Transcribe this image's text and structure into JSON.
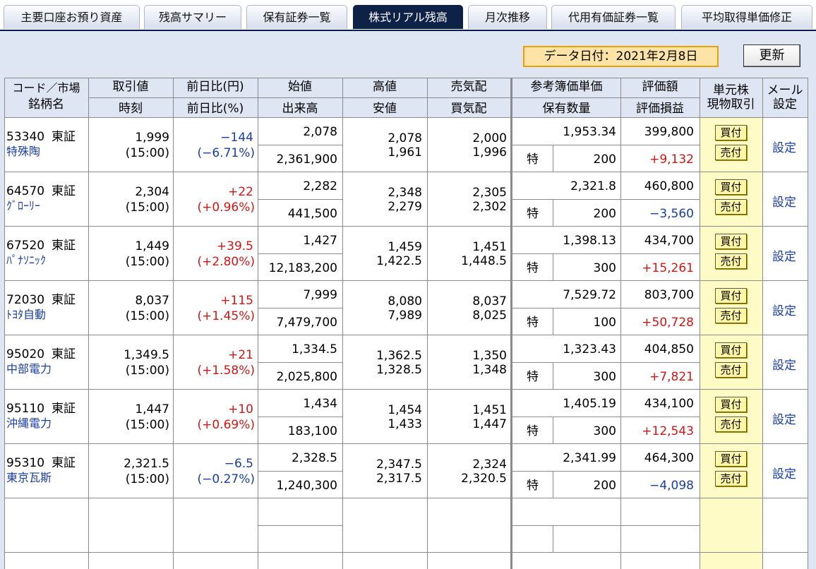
{
  "tabs": [
    {
      "label": "主要口座お預り資産",
      "active": false
    },
    {
      "label": "残高サマリー",
      "active": false
    },
    {
      "label": "保有証券一覧",
      "active": false
    },
    {
      "label": "株式リアル残高",
      "active": true
    },
    {
      "label": "月次推移",
      "active": false
    },
    {
      "label": "代用有価証券一覧",
      "active": false
    },
    {
      "label": "平均取得単価修正",
      "active": false
    }
  ],
  "toolbar": {
    "date_label": "データ日付：2021年2月8日",
    "update_label": "更新"
  },
  "headers": {
    "code_market": "コード／市場",
    "name": "銘柄名",
    "trade_price": "取引値",
    "time": "時刻",
    "change_yen": "前日比(円)",
    "change_pct": "前日比(%)",
    "open": "始値",
    "volume": "出来高",
    "high": "高値",
    "low": "安値",
    "ask": "売気配",
    "bid": "買気配",
    "ref_price": "参考簿価単価",
    "holding_qty": "保有数量",
    "valuation": "評価額",
    "pl": "評価損益",
    "unit_trade_1": "単元株",
    "unit_trade_2": "現物取引",
    "mail_1": "メール",
    "mail_2": "設定"
  },
  "colors": {
    "positive": "#d41515",
    "negative": "#1a3ea1",
    "accent": "#0e2146"
  },
  "buttons": {
    "buy": "買付",
    "sell": "売付",
    "setting": "設定"
  },
  "rows": [
    {
      "code": "53340",
      "market": "東証",
      "name": "特殊陶",
      "price": "1,999",
      "time": "(15:00)",
      "chg": "−144",
      "chg_pct": "(−6.71%)",
      "dir": "down",
      "open": "2,078",
      "volume": "2,361,900",
      "high": "2,078",
      "low": "1,961",
      "ask": "2,000",
      "bid": "1,996",
      "ref": "1,953.34",
      "type": "特",
      "qty": "200",
      "value": "399,800",
      "pl": "+9,132",
      "pl_dir": "up"
    },
    {
      "code": "64570",
      "market": "東証",
      "name": "ｸﾞﾛｰﾘｰ",
      "price": "2,304",
      "time": "(15:00)",
      "chg": "+22",
      "chg_pct": "(+0.96%)",
      "dir": "up",
      "open": "2,282",
      "volume": "441,500",
      "high": "2,348",
      "low": "2,279",
      "ask": "2,305",
      "bid": "2,302",
      "ref": "2,321.8",
      "type": "特",
      "qty": "200",
      "value": "460,800",
      "pl": "−3,560",
      "pl_dir": "down"
    },
    {
      "code": "67520",
      "market": "東証",
      "name": "ﾊﾟﾅｿﾆｯｸ",
      "price": "1,449",
      "time": "(15:00)",
      "chg": "+39.5",
      "chg_pct": "(+2.80%)",
      "dir": "up",
      "open": "1,427",
      "volume": "12,183,200",
      "high": "1,459",
      "low": "1,422.5",
      "ask": "1,451",
      "bid": "1,448.5",
      "ref": "1,398.13",
      "type": "特",
      "qty": "300",
      "value": "434,700",
      "pl": "+15,261",
      "pl_dir": "up"
    },
    {
      "code": "72030",
      "market": "東証",
      "name": "ﾄﾖﾀ自動",
      "price": "8,037",
      "time": "(15:00)",
      "chg": "+115",
      "chg_pct": "(+1.45%)",
      "dir": "up",
      "open": "7,999",
      "volume": "7,479,700",
      "high": "8,080",
      "low": "7,989",
      "ask": "8,037",
      "bid": "8,025",
      "ref": "7,529.72",
      "type": "特",
      "qty": "100",
      "value": "803,700",
      "pl": "+50,728",
      "pl_dir": "up"
    },
    {
      "code": "95020",
      "market": "東証",
      "name": "中部電力",
      "price": "1,349.5",
      "time": "(15:00)",
      "chg": "+21",
      "chg_pct": "(+1.58%)",
      "dir": "up",
      "open": "1,334.5",
      "volume": "2,025,800",
      "high": "1,362.5",
      "low": "1,328.5",
      "ask": "1,350",
      "bid": "1,348",
      "ref": "1,323.43",
      "type": "特",
      "qty": "300",
      "value": "404,850",
      "pl": "+7,821",
      "pl_dir": "up"
    },
    {
      "code": "95110",
      "market": "東証",
      "name": "沖縄電力",
      "price": "1,447",
      "time": "(15:00)",
      "chg": "+10",
      "chg_pct": "(+0.69%)",
      "dir": "up",
      "open": "1,434",
      "volume": "183,100",
      "high": "1,454",
      "low": "1,433",
      "ask": "1,451",
      "bid": "1,447",
      "ref": "1,405.19",
      "type": "特",
      "qty": "300",
      "value": "434,100",
      "pl": "+12,543",
      "pl_dir": "up"
    },
    {
      "code": "95310",
      "market": "東証",
      "name": "東京瓦斯",
      "price": "2,321.5",
      "time": "(15:00)",
      "chg": "−6.5",
      "chg_pct": "(−0.27%)",
      "dir": "down",
      "open": "2,328.5",
      "volume": "1,240,300",
      "high": "2,347.5",
      "low": "2,317.5",
      "ask": "2,324",
      "bid": "2,320.5",
      "ref": "2,341.99",
      "type": "特",
      "qty": "200",
      "value": "464,300",
      "pl": "−4,098",
      "pl_dir": "down"
    }
  ]
}
